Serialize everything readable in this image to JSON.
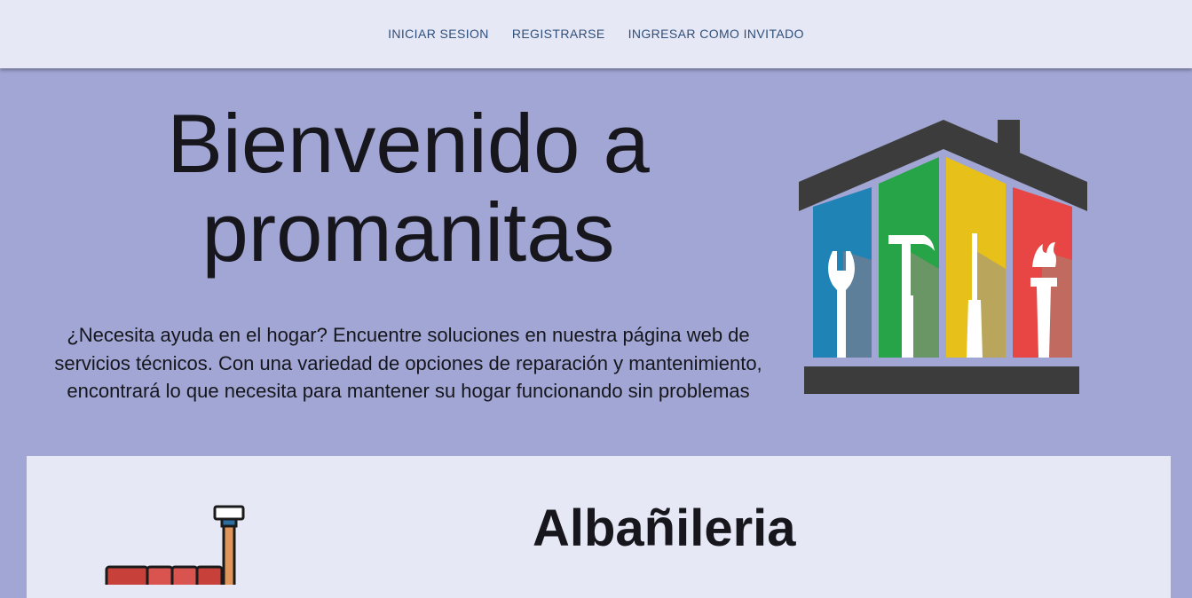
{
  "nav": {
    "items": [
      {
        "label": "INICIAR SESION"
      },
      {
        "label": "REGISTRARSE"
      },
      {
        "label": "INGRESAR COMO INVITADO"
      }
    ]
  },
  "hero": {
    "title_line1": "Bienvenido a",
    "title_line2": "promanitas",
    "description": "¿Necesita ayuda en el hogar? Encuentre soluciones en nuestra página web de servicios técnicos. Con una variedad de opciones de reparación y mantenimiento, encontrará lo que necesita para mantener su hogar funcionando sin problemas",
    "logo_icon": "house-tools-logo-icon"
  },
  "services": [
    {
      "title": "Albañileria",
      "icon": "brick-wall-trowel-icon"
    }
  ],
  "colors": {
    "page_background": "#a1a6d4",
    "topbar_background": "#e6e8f5",
    "nav_link": "#2f4f7a",
    "card_background": "#e6e8f5",
    "logo_blue": "#1f83b5",
    "logo_green": "#27a348",
    "logo_yellow": "#e8c01a",
    "logo_red": "#e84545",
    "logo_roof": "#3c3c3c"
  }
}
